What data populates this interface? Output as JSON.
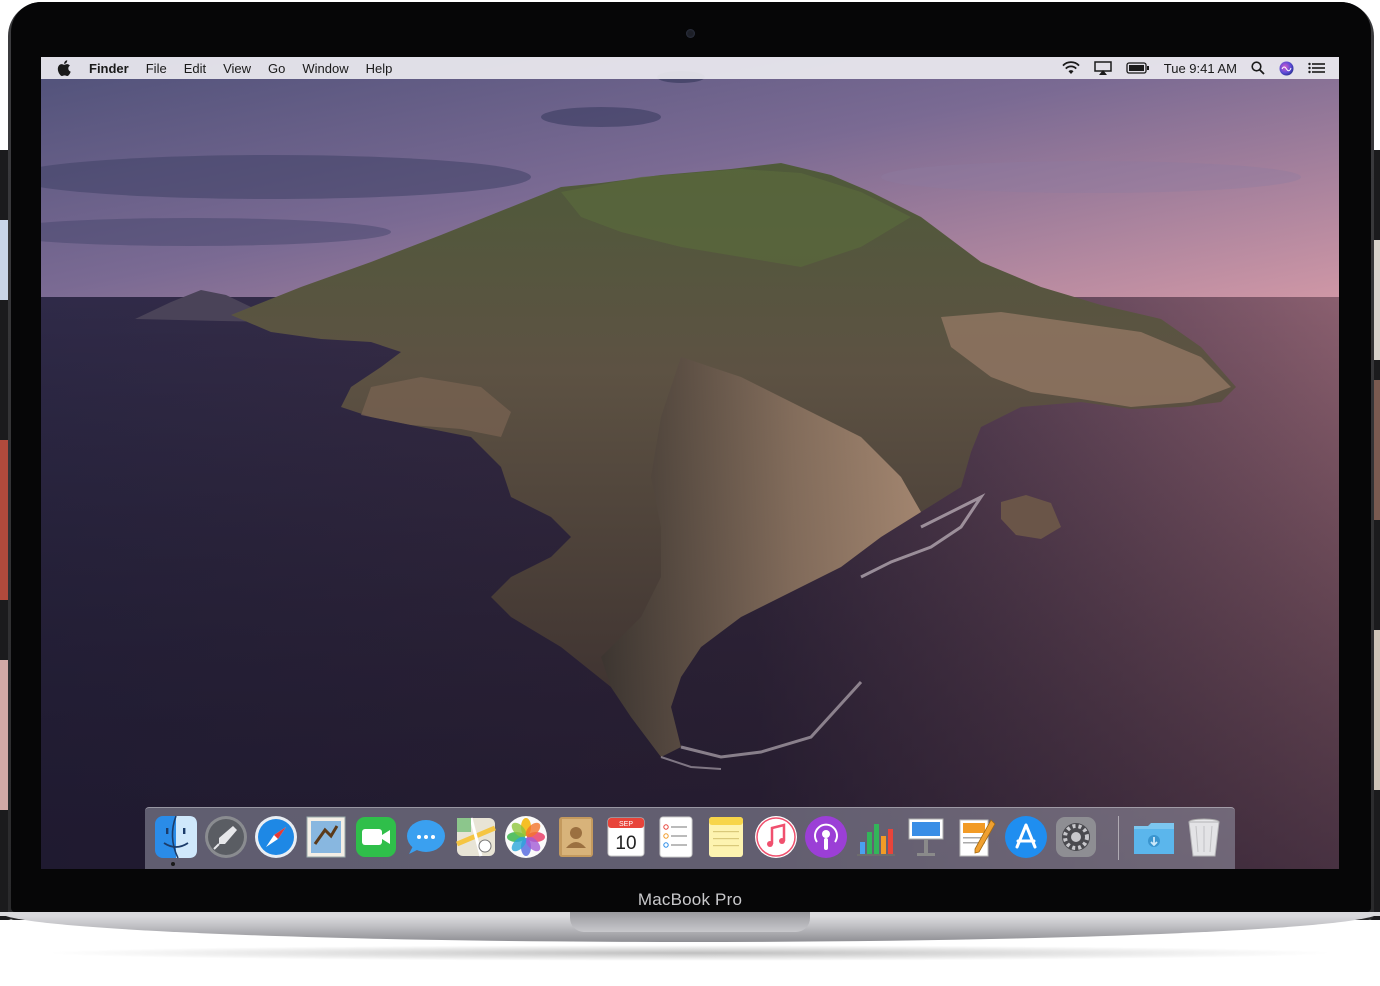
{
  "device": {
    "label": "MacBook Pro"
  },
  "menubar": {
    "app_name": "Finder",
    "menus": [
      "File",
      "Edit",
      "View",
      "Go",
      "Window",
      "Help"
    ],
    "clock": "Tue 9:41 AM",
    "status_icons": [
      "wifi-icon",
      "airplay-icon",
      "battery-icon",
      "spotlight-search-icon",
      "siri-icon",
      "notification-center-icon"
    ]
  },
  "dock": {
    "apps": [
      {
        "name": "Finder",
        "icon": "finder-icon",
        "running": true
      },
      {
        "name": "Launchpad",
        "icon": "launchpad-icon"
      },
      {
        "name": "Safari",
        "icon": "safari-icon"
      },
      {
        "name": "Mail",
        "icon": "mail-icon"
      },
      {
        "name": "FaceTime",
        "icon": "facetime-icon"
      },
      {
        "name": "Messages",
        "icon": "messages-icon"
      },
      {
        "name": "Maps",
        "icon": "maps-icon"
      },
      {
        "name": "Photos",
        "icon": "photos-icon"
      },
      {
        "name": "Contacts",
        "icon": "contacts-icon"
      },
      {
        "name": "Calendar",
        "icon": "calendar-icon",
        "month": "SEP",
        "day": "10"
      },
      {
        "name": "Reminders",
        "icon": "reminders-icon"
      },
      {
        "name": "Notes",
        "icon": "notes-icon"
      },
      {
        "name": "Music",
        "icon": "music-icon"
      },
      {
        "name": "Podcasts",
        "icon": "podcasts-icon"
      },
      {
        "name": "Numbers",
        "icon": "numbers-icon"
      },
      {
        "name": "Keynote",
        "icon": "keynote-icon"
      },
      {
        "name": "Pages",
        "icon": "pages-icon"
      },
      {
        "name": "App Store",
        "icon": "app-store-icon"
      },
      {
        "name": "System Preferences",
        "icon": "system-preferences-icon"
      }
    ],
    "folders": [
      {
        "name": "Downloads",
        "icon": "downloads-folder-icon"
      },
      {
        "name": "Trash",
        "icon": "trash-icon"
      }
    ]
  },
  "colors": {
    "sky_top": "#5b5a86",
    "sky_bottom": "#c58a9a",
    "sea": "#3c2f4d",
    "rock": "#6e5a4d"
  }
}
